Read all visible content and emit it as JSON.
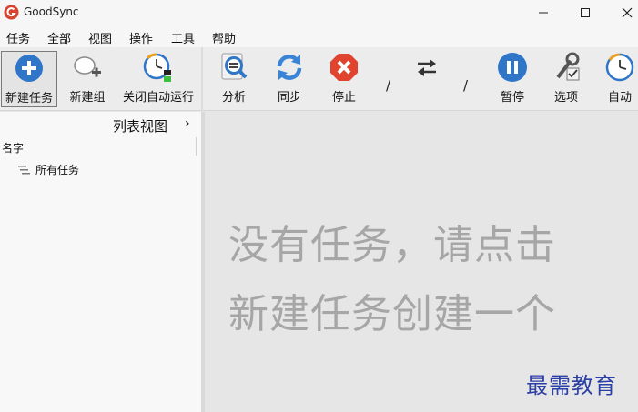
{
  "app": {
    "title": "GoodSync",
    "icon": "goodsync-logo-icon"
  },
  "window_controls": {
    "minimize": "minimize-icon",
    "maximize": "maximize-icon",
    "close": "close-icon"
  },
  "menu": [
    "任务",
    "全部",
    "视图",
    "操作",
    "工具",
    "帮助"
  ],
  "toolbar": {
    "new_job": "新建任务",
    "new_group": "新建组",
    "disable_auto": "关闭自动运行",
    "analyze": "分析",
    "sync": "同步",
    "stop": "停止",
    "pause": "暂停",
    "options": "选项",
    "auto": "自动",
    "separator_slash": "/"
  },
  "left_panel": {
    "view_title": "列表视图",
    "view_arrow": "›",
    "column_name": "名字",
    "tree": [
      {
        "label": "所有任务",
        "icon": "list-icon"
      }
    ]
  },
  "main_panel": {
    "empty_line1": "没有任务，请点击",
    "empty_line2": "新建任务创建一个"
  },
  "watermark": "最需教育",
  "colors": {
    "accent_blue": "#2f76c9",
    "sync_blue": "#3a84d8",
    "stop_red": "#e0442e",
    "logo_red": "#d6432e",
    "clock_accent": "#f0a020",
    "watermark_blue": "#2b3fa5"
  }
}
